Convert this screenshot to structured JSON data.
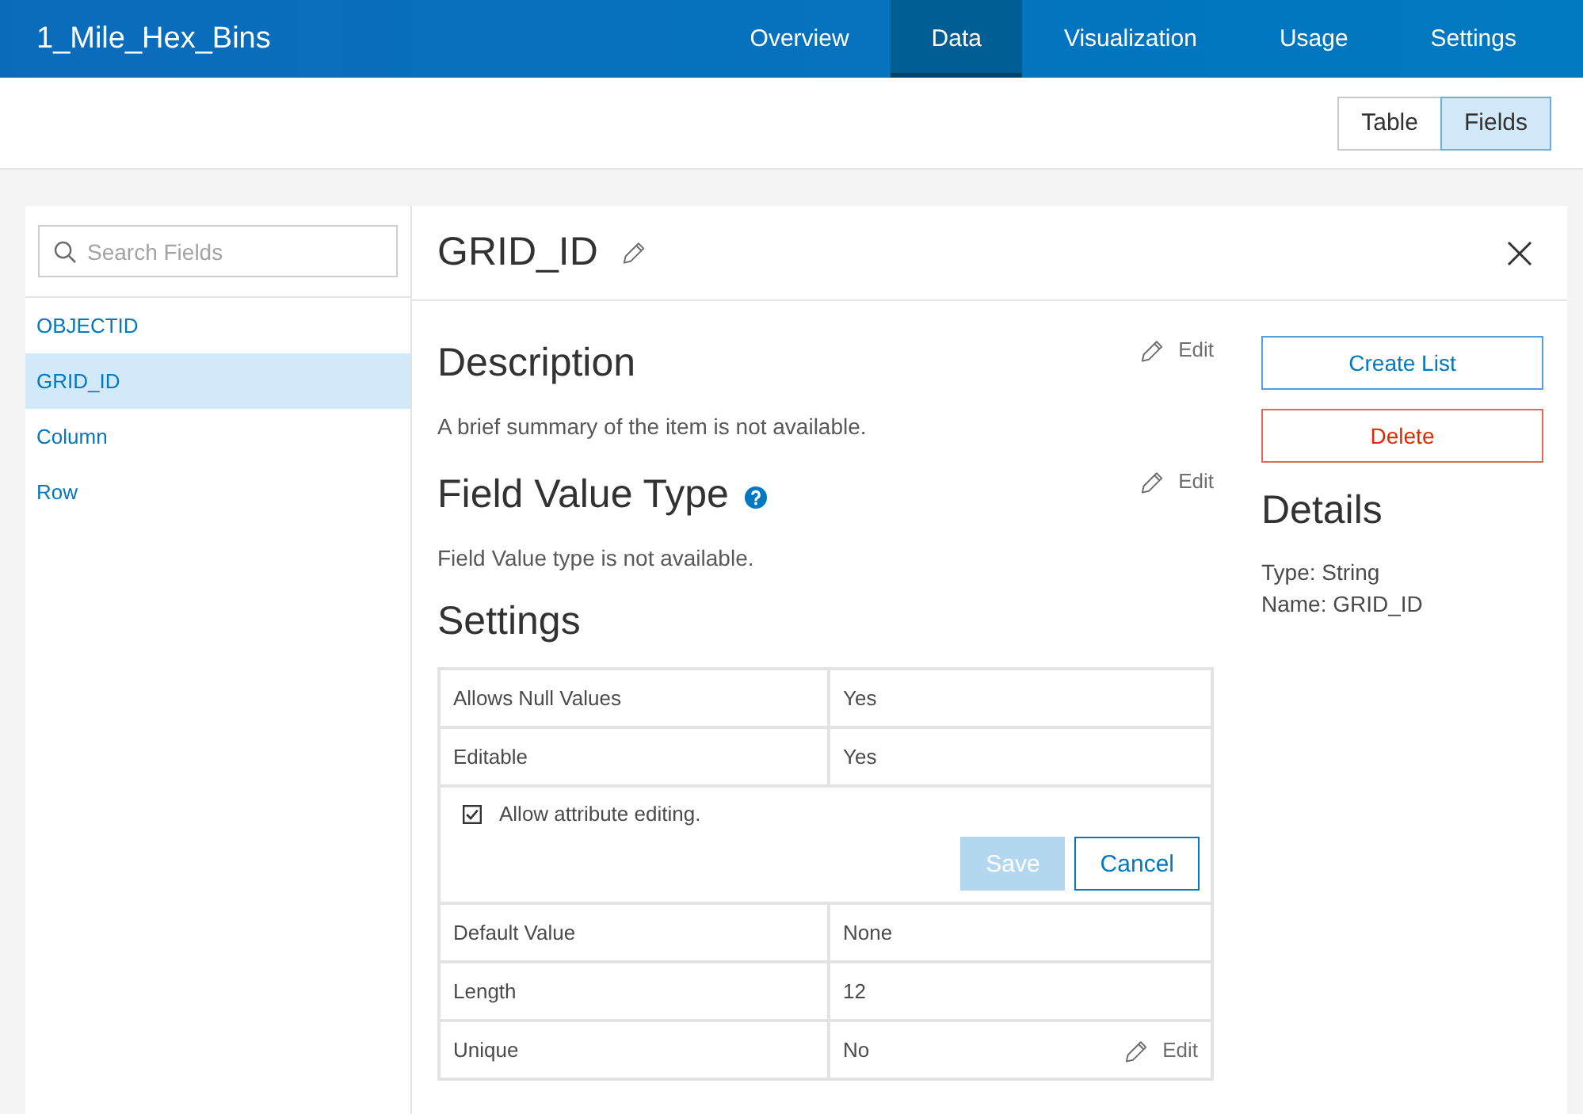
{
  "header": {
    "title": "1_Mile_Hex_Bins",
    "tabs": [
      {
        "label": "Overview",
        "selected": false
      },
      {
        "label": "Data",
        "selected": true
      },
      {
        "label": "Visualization",
        "selected": false
      },
      {
        "label": "Usage",
        "selected": false
      },
      {
        "label": "Settings",
        "selected": false
      }
    ]
  },
  "view_toggle": [
    {
      "label": "Table",
      "selected": false
    },
    {
      "label": "Fields",
      "selected": true
    }
  ],
  "sidebar": {
    "search": {
      "placeholder": "Search Fields"
    },
    "items": [
      {
        "label": "OBJECTID",
        "selected": false
      },
      {
        "label": "GRID_ID",
        "selected": true
      },
      {
        "label": "Column",
        "selected": false
      },
      {
        "label": "Row",
        "selected": false
      }
    ]
  },
  "field_panel": {
    "title": "GRID_ID",
    "sections": [
      {
        "heading": "Description",
        "help": false,
        "edit": "Edit",
        "text": "A brief summary of the item is not available."
      },
      {
        "heading": "Field Value Type",
        "help": true,
        "edit": "Edit",
        "text": "Field Value type is not available."
      }
    ],
    "settings": {
      "heading": "Settings",
      "rows": [
        {
          "kind": "pair",
          "label": "Allows Null Values",
          "value": "Yes"
        },
        {
          "kind": "pair",
          "label": "Editable",
          "value": "Yes"
        },
        {
          "kind": "editor",
          "checkbox": {
            "label": "Allow attribute editing.",
            "checked": true
          },
          "buttons": [
            {
              "label": "Save",
              "kind": "filled",
              "disabled": true
            },
            {
              "label": "Cancel",
              "kind": "outline",
              "disabled": false
            }
          ]
        },
        {
          "kind": "pair",
          "label": "Default Value",
          "value": "None"
        },
        {
          "kind": "pair",
          "label": "Length",
          "value": "12"
        },
        {
          "kind": "pair",
          "label": "Unique",
          "value": "No",
          "edit": "Edit"
        }
      ]
    },
    "actions": [
      {
        "label": "Create List",
        "kind": "outline"
      },
      {
        "label": "Delete",
        "kind": "danger"
      }
    ],
    "details": {
      "heading": "Details",
      "lines": [
        "Type: String",
        "Name: GRID_ID"
      ]
    }
  }
}
